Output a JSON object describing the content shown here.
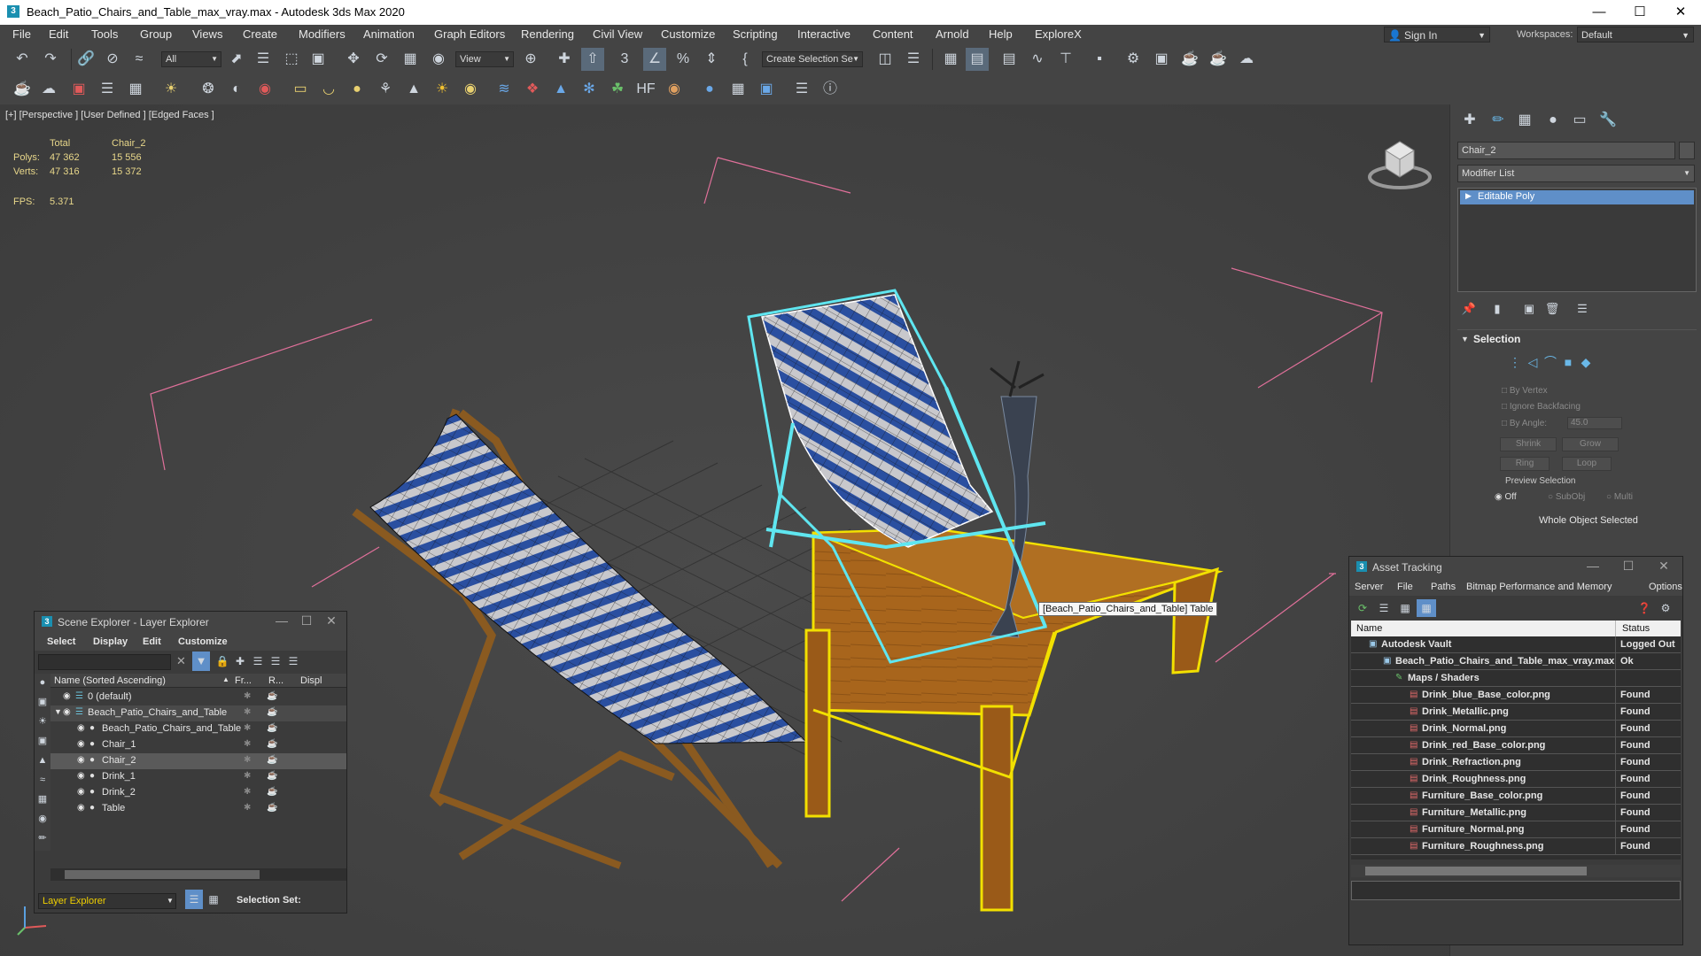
{
  "window": {
    "title": "Beach_Patio_Chairs_and_Table_max_vray.max - Autodesk 3ds Max 2020",
    "app_icon": "3"
  },
  "menu": {
    "items": [
      "File",
      "Edit",
      "Tools",
      "Group",
      "Views",
      "Create",
      "Modifiers",
      "Animation",
      "Graph Editors",
      "Rendering",
      "Civil View",
      "Customize",
      "Scripting",
      "Interactive",
      "Content",
      "Arnold",
      "Help",
      "ExploreX"
    ],
    "sign_in": "Sign In",
    "workspaces_label": "Workspaces:",
    "workspaces_value": "Default"
  },
  "toolbar": {
    "selection_filter": "All",
    "ref_coord": "View",
    "named_selection": "Create Selection Se"
  },
  "viewport": {
    "label": "[+] [Perspective ] [User Defined ] [Edged Faces ]",
    "stats": {
      "total_header": "Total",
      "object_header": "Chair_2",
      "polys_label": "Polys:",
      "polys_total": "47 362",
      "polys_object": "15 556",
      "verts_label": "Verts:",
      "verts_total": "47 316",
      "verts_object": "15 372",
      "fps_label": "FPS:",
      "fps_value": "5.371"
    },
    "tooltip": "[Beach_Patio_Chairs_and_Table] Table",
    "colors": {
      "background": "#434343",
      "selected_wire": "#5fe6f0",
      "highlight_wire": "#f2e000",
      "wood": "#a8651c",
      "fabric_blue": "#2a4fa0",
      "grid_helper": "#e0709a"
    }
  },
  "command_panel": {
    "object_name": "Chair_2",
    "modifier_list": "Modifier List",
    "stack_item": "Editable Poly",
    "selection_title": "Selection",
    "by_vertex": "By Vertex",
    "ignore_backfacing": "Ignore Backfacing",
    "by_angle": "By Angle:",
    "angle_value": "45.0",
    "shrink": "Shrink",
    "grow": "Grow",
    "ring": "Ring",
    "loop": "Loop",
    "preview_selection": "Preview Selection",
    "preview_off": "Off",
    "preview_subobj": "SubObj",
    "preview_multi": "Multi",
    "status": "Whole Object Selected"
  },
  "scene_explorer": {
    "title": "Scene Explorer - Layer Explorer",
    "menu": [
      "Select",
      "Display",
      "Edit",
      "Customize"
    ],
    "col_name": "Name (Sorted Ascending)",
    "col_fr": "Fr...",
    "col_r": "R...",
    "col_disp": "Displ",
    "rows": [
      {
        "label": "0 (default)",
        "indent": 0,
        "selected": false
      },
      {
        "label": "Beach_Patio_Chairs_and_Table",
        "indent": 0,
        "selected": false
      },
      {
        "label": "Beach_Patio_Chairs_and_Table",
        "indent": 1,
        "selected": false
      },
      {
        "label": "Chair_1",
        "indent": 1,
        "selected": false
      },
      {
        "label": "Chair_2",
        "indent": 1,
        "selected": true
      },
      {
        "label": "Drink_1",
        "indent": 1,
        "selected": false
      },
      {
        "label": "Drink_2",
        "indent": 1,
        "selected": false
      },
      {
        "label": "Table",
        "indent": 1,
        "selected": false
      }
    ],
    "footer_explorer": "Layer Explorer",
    "footer_selection_set": "Selection Set:"
  },
  "asset_tracking": {
    "title": "Asset Tracking",
    "menu": [
      "Server",
      "File",
      "Paths",
      "Bitmap Performance and Memory",
      "Options"
    ],
    "col_name": "Name",
    "col_status": "Status",
    "rows": [
      {
        "name": "Autodesk Vault",
        "status": "Logged Out",
        "level": 0
      },
      {
        "name": "Beach_Patio_Chairs_and_Table_max_vray.max",
        "status": "Ok",
        "level": 1
      },
      {
        "name": "Maps / Shaders",
        "status": "",
        "level": 2
      },
      {
        "name": "Drink_blue_Base_color.png",
        "status": "Found",
        "level": 3
      },
      {
        "name": "Drink_Metallic.png",
        "status": "Found",
        "level": 3
      },
      {
        "name": "Drink_Normal.png",
        "status": "Found",
        "level": 3
      },
      {
        "name": "Drink_red_Base_color.png",
        "status": "Found",
        "level": 3
      },
      {
        "name": "Drink_Refraction.png",
        "status": "Found",
        "level": 3
      },
      {
        "name": "Drink_Roughness.png",
        "status": "Found",
        "level": 3
      },
      {
        "name": "Furniture_Base_color.png",
        "status": "Found",
        "level": 3
      },
      {
        "name": "Furniture_Metallic.png",
        "status": "Found",
        "level": 3
      },
      {
        "name": "Furniture_Normal.png",
        "status": "Found",
        "level": 3
      },
      {
        "name": "Furniture_Roughness.png",
        "status": "Found",
        "level": 3
      }
    ]
  }
}
